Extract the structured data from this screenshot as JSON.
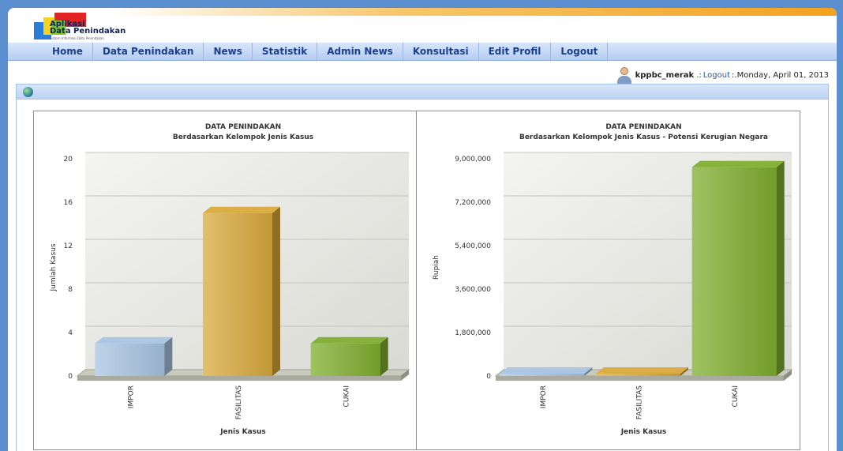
{
  "app": {
    "logo_line1": "Aplikasi",
    "logo_line2": "Data Penindakan",
    "logo_tagline": "Sistem Informasi Data Penindakan"
  },
  "nav": {
    "items": [
      {
        "label": "Home"
      },
      {
        "label": "Data Penindakan"
      },
      {
        "label": "News"
      },
      {
        "label": "Statistik"
      },
      {
        "label": "Admin News"
      },
      {
        "label": "Konsultasi"
      },
      {
        "label": "Edit Profil"
      },
      {
        "label": "Logout"
      }
    ]
  },
  "user": {
    "username": "kppbc_merak",
    "separator1": ".:",
    "logout_label": "Logout",
    "separator2": ":.",
    "date": "Monday, April 01, 2013"
  },
  "colors": {
    "impor": "#a8c4e2",
    "fasilitas": "#d9a93c",
    "cukai": "#7fae2e"
  },
  "chart_data": [
    {
      "type": "bar",
      "title": "DATA PENINDAKAN",
      "subtitle": "Berdasarkan Kelompok Jenis Kasus",
      "xlabel": "Jenis Kasus",
      "ylabel": "Jumlah Kasus",
      "categories": [
        "IMPOR",
        "FASILITAS",
        "CUKAI"
      ],
      "values": [
        3,
        15,
        3
      ],
      "ylim": [
        0,
        20
      ],
      "yticks": [
        "0",
        "4",
        "8",
        "12",
        "16",
        "20"
      ],
      "grid": true
    },
    {
      "type": "bar",
      "title": "DATA PENINDAKAN",
      "subtitle": "Berdasarkan Kelompok Jenis Kasus - Potensi Kerugian Negara",
      "xlabel": "Jenis Kasus",
      "ylabel": "Rupiah",
      "categories": [
        "IMPOR",
        "FASILITAS",
        "CUKAI"
      ],
      "values": [
        0,
        0,
        8650000
      ],
      "ylim": [
        0,
        9000000
      ],
      "yticks": [
        "0",
        "1,800,000",
        "3,600,000",
        "5,400,000",
        "7,200,000",
        "9,000,000"
      ],
      "grid": true
    }
  ]
}
